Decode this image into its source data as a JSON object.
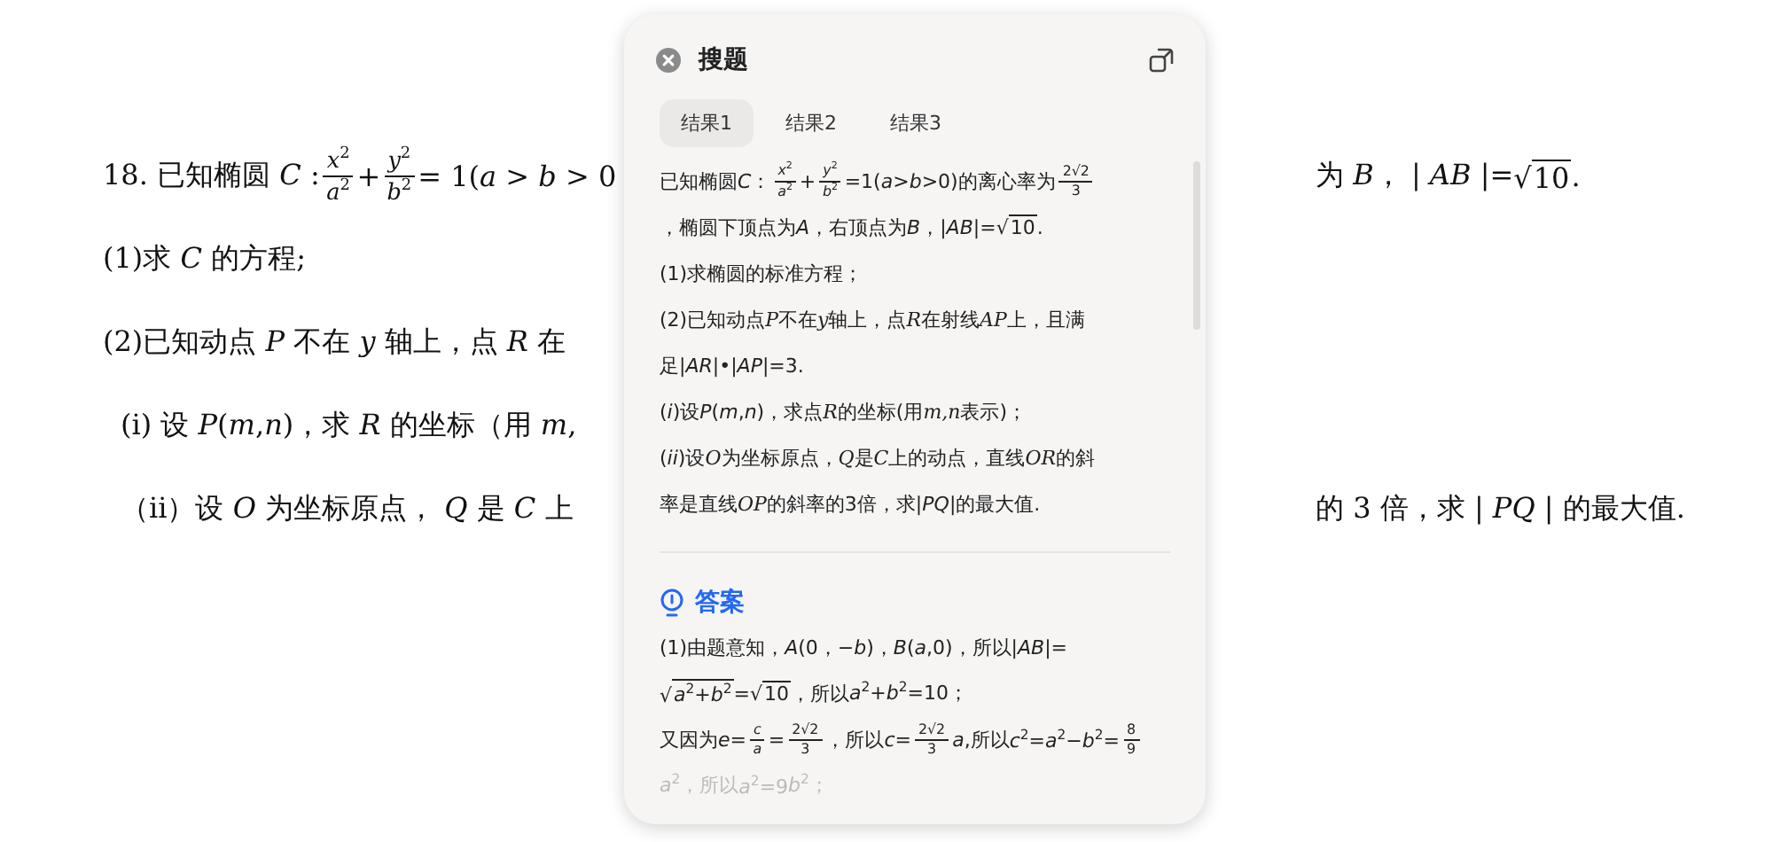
{
  "document": {
    "lines": [
      {
        "indented": false,
        "left": [
          {
            "kind": "text",
            "text": "18.  已知椭圆 *C* :"
          },
          {
            "kind": "frac",
            "num": "*x*$^{2}$",
            "den": "*a*$^{2}$"
          },
          {
            "kind": "text",
            "text": "+"
          },
          {
            "kind": "frac",
            "num": "*y*$^{2}$",
            "den": "*b*$^{2}$"
          },
          {
            "kind": "text",
            "text": "= 1(*a* > *b* > 0"
          }
        ],
        "right": [
          {
            "kind": "text",
            "text": "为 *B*，  | *AB* |="
          },
          {
            "kind": "sqrt",
            "sign": "√",
            "text": "10"
          },
          {
            "kind": "text",
            "text": " ."
          }
        ]
      },
      {
        "indented": false,
        "left": [
          {
            "kind": "text",
            "text": "(1)求 *C* 的方程;"
          }
        ]
      },
      {
        "indented": false,
        "left": [
          {
            "kind": "text",
            "text": "(2)已知动点 *P* 不在 *y* 轴上，点 *R* 在"
          }
        ]
      },
      {
        "indented": true,
        "left": [
          {
            "kind": "text",
            "text": "(i) 设 *P*(*m*,*n*)，求 *R* 的坐标（用 *m*,"
          }
        ]
      },
      {
        "indented": true,
        "left": [
          {
            "kind": "text",
            "text": "（ii）设 *O* 为坐标原点， *Q* 是 *C* 上"
          }
        ],
        "right": [
          {
            "kind": "text",
            "text": "的 3 倍，求 | *PQ* | 的最大值."
          }
        ]
      }
    ]
  },
  "panel": {
    "title": "搜题",
    "tabs": [
      {
        "label": "结果1",
        "selected": true
      },
      {
        "label": "结果2",
        "selected": false
      },
      {
        "label": "结果3",
        "selected": false
      }
    ],
    "question": [
      [
        {
          "kind": "text",
          "text": "已知椭圆"
        },
        {
          "kind": "text",
          "text": "*C*："
        },
        {
          "kind": "frac",
          "num": "*x*$^{2}$",
          "den": "*a*$^{2}$"
        },
        {
          "kind": "text",
          "text": " + "
        },
        {
          "kind": "frac",
          "num": "*y*$^{2}$",
          "den": "*b*$^{2}$"
        },
        {
          "kind": "text",
          "text": "=1(*a*>*b*>0)的离心率为"
        },
        {
          "kind": "frac",
          "num": "2√2",
          "den": "3"
        }
      ],
      [
        {
          "kind": "text",
          "text": "，椭圆下顶点为"
        },
        {
          "kind": "text",
          "text": "*A*，右顶点为"
        },
        {
          "kind": "text",
          "text": "*B*，|*AB*|="
        },
        {
          "kind": "sqrt",
          "sign": "√",
          "text": "10"
        },
        {
          "kind": "text",
          "text": "."
        }
      ],
      [
        {
          "kind": "text",
          "text": "(1)求椭圆的标准方程；"
        }
      ],
      [
        {
          "kind": "text",
          "text": "(2)已知动点"
        },
        {
          "kind": "var",
          "text": "P"
        },
        {
          "kind": "text",
          "text": "不在"
        },
        {
          "kind": "var",
          "text": "y"
        },
        {
          "kind": "text",
          "text": "轴上，点"
        },
        {
          "kind": "var",
          "text": "R"
        },
        {
          "kind": "text",
          "text": "在射线"
        },
        {
          "kind": "var",
          "text": "AP"
        },
        {
          "kind": "text",
          "text": "上，且满"
        }
      ],
      [
        {
          "kind": "text",
          "text": "足|*AR*|•|*AP*|=3."
        }
      ],
      [
        {
          "kind": "text",
          "text": "(*i*)设"
        },
        {
          "kind": "text",
          "text": "*P*(*m*,*n*)，求点"
        },
        {
          "kind": "var",
          "text": "R"
        },
        {
          "kind": "text",
          "text": "的坐标(用"
        },
        {
          "kind": "var",
          "text": "m,n"
        },
        {
          "kind": "text",
          "text": "表示)；"
        }
      ],
      [
        {
          "kind": "text",
          "text": "(*ii*)设"
        },
        {
          "kind": "var",
          "text": "O"
        },
        {
          "kind": "text",
          "text": "为坐标原点，"
        },
        {
          "kind": "var",
          "text": "Q"
        },
        {
          "kind": "text",
          "text": "是"
        },
        {
          "kind": "var",
          "text": "C"
        },
        {
          "kind": "text",
          "text": "上的动点，直线"
        },
        {
          "kind": "var",
          "text": "OR"
        },
        {
          "kind": "text",
          "text": "的斜"
        }
      ],
      [
        {
          "kind": "text",
          "text": "率是直线"
        },
        {
          "kind": "var",
          "text": "OP"
        },
        {
          "kind": "text",
          "text": "的斜率的3倍，求|*PQ*|的最大值."
        }
      ]
    ],
    "answer_title": "答案",
    "answer": [
      {
        "faded": false,
        "segments": [
          {
            "kind": "text",
            "text": "(1)由题意知，"
          },
          {
            "kind": "text",
            "text": "*A*(0，−*b*)，"
          },
          {
            "kind": "text",
            "text": "*B*(*a*,0)，所以|*AB*|="
          }
        ]
      },
      {
        "faded": false,
        "segments": [
          {
            "kind": "sqrt",
            "sign": "√",
            "text": "*a*$^{2}$+*b*$^{2}$"
          },
          {
            "kind": "text",
            "text": "="
          },
          {
            "kind": "sqrt",
            "sign": "√",
            "text": "10"
          },
          {
            "kind": "text",
            "text": "，所以"
          },
          {
            "kind": "text",
            "text": "*a*$^{2}$+*b*$^{2}$=10；"
          }
        ]
      },
      {
        "faded": false,
        "segments": [
          {
            "kind": "text",
            "text": "又因为"
          },
          {
            "kind": "text",
            "text": "*e*="
          },
          {
            "kind": "frac",
            "num": "*c*",
            "den": "*a*"
          },
          {
            "kind": "text",
            "text": "="
          },
          {
            "kind": "frac",
            "num": "2√2",
            "den": "3"
          },
          {
            "kind": "text",
            "text": "，所以"
          },
          {
            "kind": "text",
            "text": "*c*="
          },
          {
            "kind": "frac",
            "num": "2√2",
            "den": "3"
          },
          {
            "kind": "text",
            "text": "*a*,所以"
          },
          {
            "kind": "text",
            "text": "*c*$^{2}$=*a*$^{2}$−*b*$^{2}$="
          },
          {
            "kind": "frac",
            "num": "8",
            "den": "9"
          }
        ]
      },
      {
        "faded": true,
        "segments": [
          {
            "kind": "text",
            "text": "*a*$^{2}$，所以"
          },
          {
            "kind": "text",
            "text": "*a*$^{2}$=9"
          },
          {
            "kind": "text",
            "text": "*b*$^{2}$；"
          }
        ]
      }
    ]
  }
}
